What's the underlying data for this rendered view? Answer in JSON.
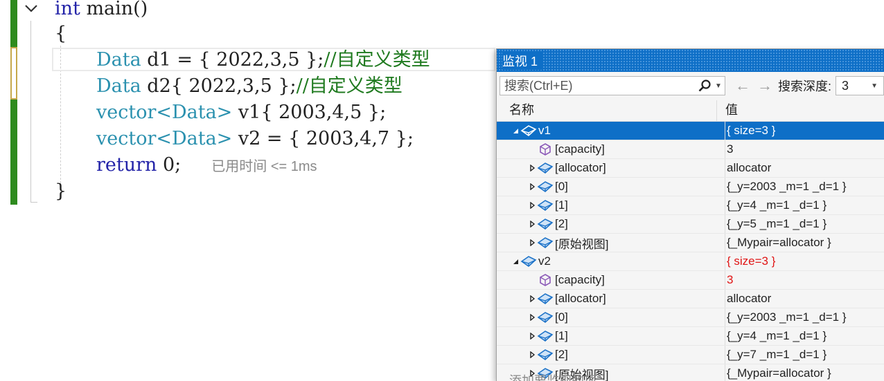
{
  "editor": {
    "lines": [
      {
        "kw": "int",
        "rest": " main()"
      },
      {
        "text": "{"
      },
      {
        "type": "Data",
        "rest": " d1 = { 2022,3,5 };",
        "comment": "//自定义类型"
      },
      {
        "type": "Data",
        "rest": " d2{ 2022,3,5 };",
        "comment": "//自定义类型"
      },
      {
        "type": "vector<Data>",
        "rest": " v1{ 2003,4,5 };"
      },
      {
        "type": "vector<Data>",
        "rest": " v2 = { 2003,4,7 };"
      },
      {
        "kw": "return",
        "rest": " 0;",
        "elapsed": "已用时间 <= 1ms"
      },
      {
        "text": "}"
      }
    ],
    "colors": {
      "keyword": "#2323a8",
      "type": "#2b91af",
      "comment": "#1f7a1f",
      "change_saved": "#2e8b1e",
      "change_unsaved": "#c6a84b"
    }
  },
  "watch": {
    "title": "监视 1",
    "search_placeholder": "搜索(Ctrl+E)",
    "depth_label": "搜索深度:",
    "depth_value": "3",
    "col_name": "名称",
    "col_value": "值",
    "rows": [
      {
        "name": "v1",
        "value": "{ size=3 }",
        "icon": "variable-icon",
        "expander": "expanded"
      },
      {
        "name": "[capacity]",
        "value": "3",
        "icon": "property-icon",
        "expander": "none"
      },
      {
        "name": "[allocator]",
        "value": "allocator",
        "icon": "variable-icon",
        "expander": "collapsed"
      },
      {
        "name": "[0]",
        "value": "{_y=2003 _m=1 _d=1 }",
        "icon": "variable-icon",
        "expander": "collapsed"
      },
      {
        "name": "[1]",
        "value": "{_y=4 _m=1 _d=1 }",
        "icon": "variable-icon",
        "expander": "collapsed"
      },
      {
        "name": "[2]",
        "value": "{_y=5 _m=1 _d=1 }",
        "icon": "variable-icon",
        "expander": "collapsed"
      },
      {
        "name": "[原始视图]",
        "value": "{_Mypair=allocator }",
        "icon": "variable-icon",
        "expander": "collapsed"
      },
      {
        "name": "v2",
        "value": "{ size=3 }",
        "icon": "variable-icon",
        "expander": "expanded"
      },
      {
        "name": "[capacity]",
        "value": "3",
        "icon": "property-icon",
        "expander": "none"
      },
      {
        "name": "[allocator]",
        "value": "allocator",
        "icon": "variable-icon",
        "expander": "collapsed"
      },
      {
        "name": "[0]",
        "value": "{_y=2003 _m=1 _d=1 }",
        "icon": "variable-icon",
        "expander": "collapsed"
      },
      {
        "name": "[1]",
        "value": "{_y=4 _m=1 _d=1 }",
        "icon": "variable-icon",
        "expander": "collapsed"
      },
      {
        "name": "[2]",
        "value": "{_y=7 _m=1 _d=1 }",
        "icon": "variable-icon",
        "expander": "collapsed"
      },
      {
        "name": "[原始视图]",
        "value": "{_Mypair=allocator }",
        "icon": "variable-icon",
        "expander": "collapsed"
      }
    ],
    "add_item_text": "添加要监视的项",
    "colors": {
      "title_bar": "#0e6fc7",
      "selected_row": "#0e6fc7",
      "changed_value": "#e01515"
    }
  }
}
